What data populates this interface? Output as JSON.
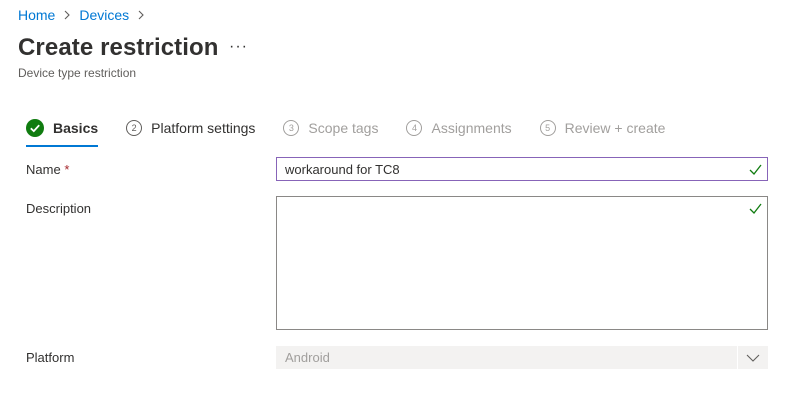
{
  "breadcrumb": {
    "items": [
      "Home",
      "Devices"
    ]
  },
  "header": {
    "title": "Create restriction",
    "more_label": "···",
    "subtitle": "Device type restriction"
  },
  "wizard": {
    "steps": [
      {
        "number": "1",
        "label": "Basics",
        "state": "active-completed"
      },
      {
        "number": "2",
        "label": "Platform settings",
        "state": "enabled"
      },
      {
        "number": "3",
        "label": "Scope tags",
        "state": "disabled"
      },
      {
        "number": "4",
        "label": "Assignments",
        "state": "disabled"
      },
      {
        "number": "5",
        "label": "Review + create",
        "state": "disabled"
      }
    ]
  },
  "form": {
    "name": {
      "label": "Name",
      "required_marker": "*",
      "value": "workaround for TC8"
    },
    "description": {
      "label": "Description",
      "value": ""
    },
    "platform": {
      "label": "Platform",
      "value": "Android"
    }
  },
  "colors": {
    "link": "#0078d4",
    "valid_check": "#107c10",
    "focus_border": "#8764b8",
    "disabled_bg": "#f3f2f1"
  }
}
